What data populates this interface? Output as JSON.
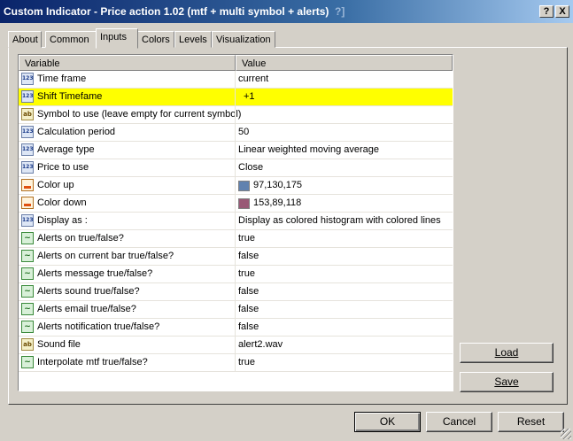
{
  "window": {
    "title": "Custom Indicator - Price action 1.02 (mtf + multi symbol + alerts)",
    "ghost_text": "?]",
    "help_button": "?",
    "close_button": "X"
  },
  "tabs": [
    "About",
    "Common",
    "Inputs",
    "Colors",
    "Levels",
    "Visualization"
  ],
  "active_tab": "Inputs",
  "grid": {
    "headers": {
      "variable": "Variable",
      "value": "Value"
    },
    "rows": [
      {
        "icon": "int-icon",
        "name": "Time frame",
        "value": "current"
      },
      {
        "icon": "int-icon",
        "name": "Shift Timefame",
        "value": "+1",
        "selected": true
      },
      {
        "icon": "string-icon",
        "name": "Symbol to use (leave empty for current symbol)",
        "value": ""
      },
      {
        "icon": "int-icon",
        "name": "Calculation period",
        "value": "50"
      },
      {
        "icon": "int-icon",
        "name": "Average type",
        "value": "Linear weighted moving average"
      },
      {
        "icon": "int-icon",
        "name": "Price to use",
        "value": "Close"
      },
      {
        "icon": "color-icon",
        "name": "Color up",
        "value": "97,130,175",
        "swatch": "#6182af"
      },
      {
        "icon": "color-icon",
        "name": "Color down",
        "value": "153,89,118",
        "swatch": "#995976"
      },
      {
        "icon": "int-icon",
        "name": "Display as :",
        "value": "Display as colored histogram with colored lines"
      },
      {
        "icon": "bool-icon",
        "name": "Alerts on true/false?",
        "value": "true"
      },
      {
        "icon": "bool-icon",
        "name": "Alerts on current bar true/false?",
        "value": "false"
      },
      {
        "icon": "bool-icon",
        "name": "Alerts message true/false?",
        "value": "true"
      },
      {
        "icon": "bool-icon",
        "name": "Alerts sound true/false?",
        "value": "false"
      },
      {
        "icon": "bool-icon",
        "name": "Alerts email true/false?",
        "value": "false"
      },
      {
        "icon": "bool-icon",
        "name": "Alerts notification true/false?",
        "value": "false"
      },
      {
        "icon": "string-icon",
        "name": "Sound file",
        "value": "alert2.wav"
      },
      {
        "icon": "bool-icon",
        "name": "Interpolate mtf true/false?",
        "value": "true"
      }
    ]
  },
  "buttons": {
    "load": "Load",
    "save": "Save",
    "ok": "OK",
    "cancel": "Cancel",
    "reset": "Reset"
  },
  "icon_glyphs": {
    "int-icon": "123",
    "string-icon": "ab",
    "bool-icon": "~",
    "color-icon": ""
  },
  "colors": {
    "title_gradient_start": "#0a246a",
    "title_gradient_end": "#a6caf0",
    "selection": "#ffff00",
    "face": "#d4d0c8"
  }
}
